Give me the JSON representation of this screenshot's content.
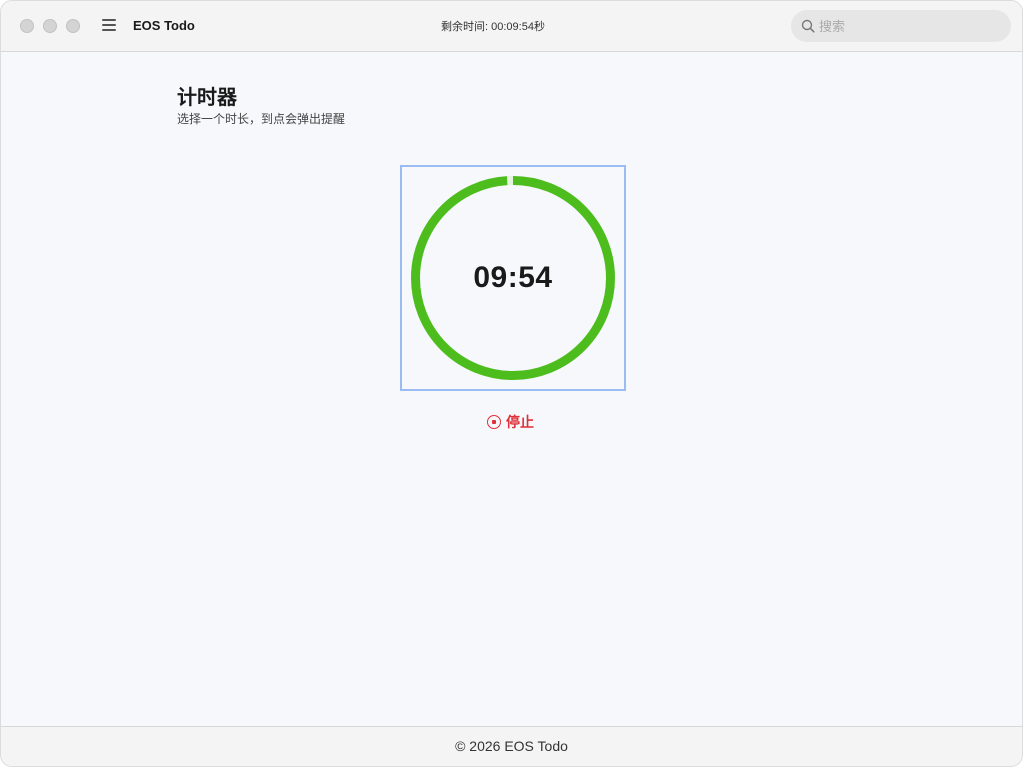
{
  "app": {
    "title": "EOS Todo"
  },
  "status": {
    "remaining_label": "剩余时间: 00:09:54秒"
  },
  "search": {
    "placeholder": "搜索",
    "value": ""
  },
  "page": {
    "title": "计时器",
    "subtitle": "选择一个时长，到点会弹出提醒"
  },
  "timer": {
    "display": "09:54",
    "progress_fraction": 0.99,
    "ring_color": "#4dbd1e"
  },
  "actions": {
    "stop_label": "停止",
    "stop_color": "#e0303a"
  },
  "footer": {
    "text": "© 2026 EOS Todo"
  },
  "icons": {
    "menu": "hamburger-menu-icon",
    "search": "search-icon",
    "stop": "stop-circle-icon"
  }
}
